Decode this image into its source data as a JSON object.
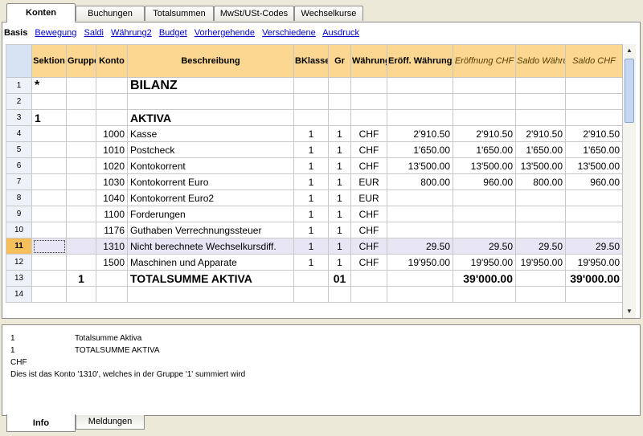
{
  "tabs": [
    {
      "label": "Konten",
      "active": true
    },
    {
      "label": "Buchungen",
      "active": false
    },
    {
      "label": "Totalsummen",
      "active": false
    },
    {
      "label": "MwSt/USt-Codes",
      "active": false
    },
    {
      "label": "Wechselkurse",
      "active": false
    }
  ],
  "views": {
    "current": "Basis",
    "links": [
      "Bewegung",
      "Saldi",
      "Währung2",
      "Budget",
      "Vorhergehende",
      "Verschiedene",
      "Ausdruck"
    ]
  },
  "columns": {
    "sektion": "Sektion",
    "gruppe": "Gruppe",
    "konto": "Konto",
    "beschreibung": "Beschreibung",
    "bklasse": "BKlasse",
    "gr": "Gr",
    "waehrung": "Währung",
    "eroeff_waehrung": "Eröff. Währung",
    "eroeffnung_chf": "Eröffnung CHF",
    "saldo_waehrung": "Saldo Währung",
    "saldo_chf": "Saldo CHF"
  },
  "rows": [
    {
      "n": "1",
      "sektion": "*",
      "gruppe": "",
      "konto": "",
      "beschreibung": "BILANZ",
      "bklasse": "",
      "gr": "",
      "waehrung": "",
      "eroeff": "",
      "eroeffchf": "",
      "saldow": "",
      "saldochf": "",
      "style": "big"
    },
    {
      "n": "2",
      "sektion": "",
      "gruppe": "",
      "konto": "",
      "beschreibung": "",
      "bklasse": "",
      "gr": "",
      "waehrung": "",
      "eroeff": "",
      "eroeffchf": "",
      "saldow": "",
      "saldochf": "",
      "style": ""
    },
    {
      "n": "3",
      "sektion": "1",
      "gruppe": "",
      "konto": "",
      "beschreibung": "AKTIVA",
      "bklasse": "",
      "gr": "",
      "waehrung": "",
      "eroeff": "",
      "eroeffchf": "",
      "saldow": "",
      "saldochf": "",
      "style": "sub"
    },
    {
      "n": "4",
      "sektion": "",
      "gruppe": "",
      "konto": "1000",
      "beschreibung": "Kasse",
      "bklasse": "1",
      "gr": "1",
      "waehrung": "CHF",
      "eroeff": "2'910.50",
      "eroeffchf": "2'910.50",
      "saldow": "2'910.50",
      "saldochf": "2'910.50",
      "style": ""
    },
    {
      "n": "5",
      "sektion": "",
      "gruppe": "",
      "konto": "1010",
      "beschreibung": "Postcheck",
      "bklasse": "1",
      "gr": "1",
      "waehrung": "CHF",
      "eroeff": "1'650.00",
      "eroeffchf": "1'650.00",
      "saldow": "1'650.00",
      "saldochf": "1'650.00",
      "style": ""
    },
    {
      "n": "6",
      "sektion": "",
      "gruppe": "",
      "konto": "1020",
      "beschreibung": "Kontokorrent",
      "bklasse": "1",
      "gr": "1",
      "waehrung": "CHF",
      "eroeff": "13'500.00",
      "eroeffchf": "13'500.00",
      "saldow": "13'500.00",
      "saldochf": "13'500.00",
      "style": ""
    },
    {
      "n": "7",
      "sektion": "",
      "gruppe": "",
      "konto": "1030",
      "beschreibung": "Kontokorrent Euro",
      "bklasse": "1",
      "gr": "1",
      "waehrung": "EUR",
      "eroeff": "800.00",
      "eroeffchf": "960.00",
      "saldow": "800.00",
      "saldochf": "960.00",
      "style": ""
    },
    {
      "n": "8",
      "sektion": "",
      "gruppe": "",
      "konto": "1040",
      "beschreibung": "Kontokorrent Euro2",
      "bklasse": "1",
      "gr": "1",
      "waehrung": "EUR",
      "eroeff": "",
      "eroeffchf": "",
      "saldow": "",
      "saldochf": "",
      "style": ""
    },
    {
      "n": "9",
      "sektion": "",
      "gruppe": "",
      "konto": "1100",
      "beschreibung": "Forderungen",
      "bklasse": "1",
      "gr": "1",
      "waehrung": "CHF",
      "eroeff": "",
      "eroeffchf": "",
      "saldow": "",
      "saldochf": "",
      "style": ""
    },
    {
      "n": "10",
      "sektion": "",
      "gruppe": "",
      "konto": "1176",
      "beschreibung": "Guthaben Verrechnungssteuer",
      "bklasse": "1",
      "gr": "1",
      "waehrung": "CHF",
      "eroeff": "",
      "eroeffchf": "",
      "saldow": "",
      "saldochf": "",
      "style": ""
    },
    {
      "n": "11",
      "sektion": "",
      "gruppe": "",
      "konto": "1310",
      "beschreibung": "Nicht berechnete Wechselkursdiff.",
      "bklasse": "1",
      "gr": "1",
      "waehrung": "CHF",
      "eroeff": "29.50",
      "eroeffchf": "29.50",
      "saldow": "29.50",
      "saldochf": "29.50",
      "style": "sel"
    },
    {
      "n": "12",
      "sektion": "",
      "gruppe": "",
      "konto": "1500",
      "beschreibung": "Maschinen und Apparate",
      "bklasse": "1",
      "gr": "1",
      "waehrung": "CHF",
      "eroeff": "19'950.00",
      "eroeffchf": "19'950.00",
      "saldow": "19'950.00",
      "saldochf": "19'950.00",
      "style": ""
    },
    {
      "n": "13",
      "sektion": "",
      "gruppe": "1",
      "konto": "",
      "beschreibung": "TOTALSUMME AKTIVA",
      "bklasse": "",
      "gr": "01",
      "waehrung": "",
      "eroeff": "",
      "eroeffchf": "39'000.00",
      "saldow": "",
      "saldochf": "39'000.00",
      "style": "total"
    },
    {
      "n": "14",
      "sektion": "",
      "gruppe": "",
      "konto": "",
      "beschreibung": "",
      "bklasse": "",
      "gr": "",
      "waehrung": "",
      "eroeff": "",
      "eroeffchf": "",
      "saldow": "",
      "saldochf": "",
      "style": ""
    }
  ],
  "info": {
    "lines": [
      {
        "k": "1",
        "v": "Totalsumme Aktiva"
      },
      {
        "k": "1",
        "v": "TOTALSUMME AKTIVA"
      },
      {
        "k": "CHF",
        "v": ""
      },
      {
        "k": "Dies ist das Konto '1310', welches in der Gruppe '1' summiert wird",
        "v": ""
      }
    ]
  },
  "bottom_tabs": [
    {
      "label": "Info",
      "active": true
    },
    {
      "label": "Meldungen",
      "active": false
    }
  ],
  "colors": {
    "header": "#fbd792",
    "row_number": "#eef2f8",
    "selected_row": "#e8e6f4",
    "selected_marker": "#f5c05c"
  }
}
